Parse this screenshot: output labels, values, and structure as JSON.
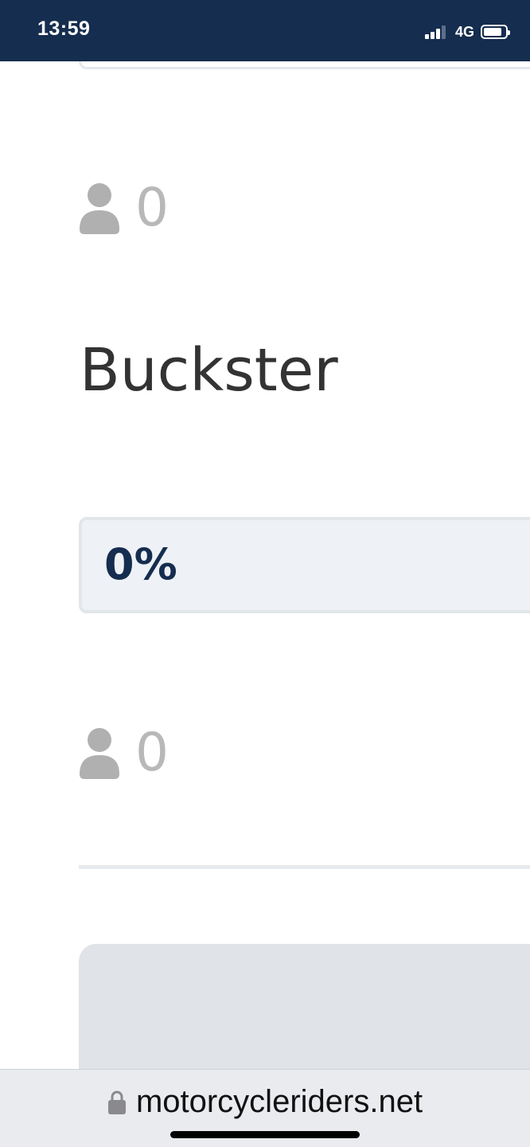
{
  "status_bar": {
    "time": "13:59",
    "network": "4G",
    "signal_icon": "cellular-signal-icon",
    "battery_icon": "battery-icon",
    "background": "#152d4f"
  },
  "poll": {
    "first_vote": {
      "icon": "user-icon",
      "count": "0"
    },
    "option": {
      "name": "Buckster",
      "percent_label": "0%",
      "percent_value": 0
    },
    "second_vote": {
      "icon": "user-icon",
      "count": "0"
    },
    "accent_color": "#152d4f"
  },
  "browser": {
    "url": "motorcycleriders.net",
    "lock_icon": "lock-icon"
  }
}
